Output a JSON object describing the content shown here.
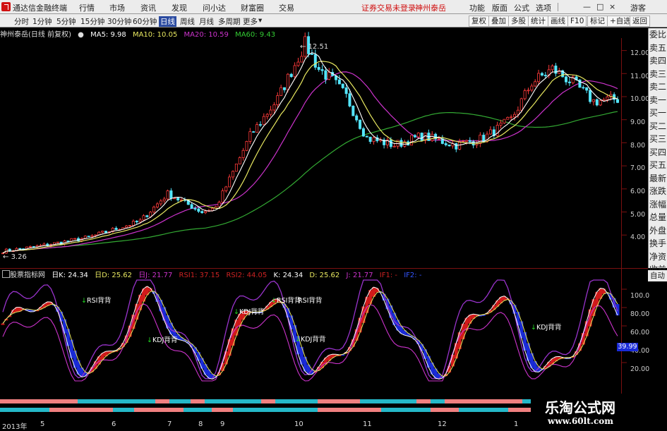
{
  "menubar": {
    "app_title": "通达信金融终端",
    "menus": [
      "行情",
      "市场",
      "资讯",
      "发现",
      "问小达",
      "财富圈",
      "交易"
    ],
    "notice": "证券交易未登录",
    "stock_name": "神州泰岳",
    "right_items": [
      "功能",
      "版面",
      "公式",
      "选项"
    ],
    "guest": "游客"
  },
  "periodbar": {
    "periods": [
      "分时",
      "1分钟",
      "5分钟",
      "15分钟",
      "30分钟",
      "60分钟",
      "日线",
      "周线",
      "月线",
      "多周期",
      "更多"
    ],
    "active_period": "日线",
    "buttons": [
      "复权",
      "叠加",
      "多股",
      "统计",
      "画线",
      "F10",
      "标记",
      "+自选",
      "返回"
    ]
  },
  "chart_info": {
    "title": "神州泰岳(日线 前复权)",
    "ma5": "MA5: 9.98",
    "ma10": "MA10: 10.05",
    "ma20": "MA20: 10.59",
    "ma60": "MA60: 9.43",
    "high_label": "12.51",
    "low_label": "3.26",
    "colors": {
      "ma5": "#ffffff",
      "ma10": "#e8e860",
      "ma20": "#cc33cc",
      "ma60": "#33aa33"
    }
  },
  "indicator": {
    "name": "股票指标网",
    "values": [
      "日K: 24.34",
      "日D: 25.62",
      "日J: 21.77",
      "RSI1: 37.15",
      "RSI2: 44.05",
      "K: 24.34",
      "D: 25.62",
      "J: 21.77",
      "IF1: -",
      "IF2: -"
    ],
    "current": "39.99",
    "signals": [
      {
        "text": "RSI背背"
      },
      {
        "text": "KDJ背背"
      },
      {
        "text": "KDJ背背"
      },
      {
        "text": "RSI背背"
      },
      {
        "text": "RSI背背"
      },
      {
        "text": "KDJ背背"
      },
      {
        "text": "KDJ背背"
      }
    ]
  },
  "right_panel": {
    "items": [
      "委比",
      "卖五",
      "卖四",
      "卖三",
      "卖二",
      "卖一",
      "买一",
      "买二",
      "买三",
      "买四",
      "买五",
      "最新",
      "涨跌",
      "涨幅",
      "总量",
      "外盘",
      "换手",
      "净资",
      "收益"
    ],
    "auto_label": "自动"
  },
  "price_axis": [
    "12.00",
    "11.00",
    "10.00",
    "9.00",
    "8.00",
    "7.00",
    "6.00",
    "5.00",
    "4.00"
  ],
  "ind_axis": [
    "100.0",
    "80.00",
    "60.00",
    "40.00",
    "20.00"
  ],
  "x_axis": [
    "2013年",
    "5",
    "6",
    "7",
    "8",
    "9",
    "10",
    "11",
    "12",
    "1"
  ],
  "watermark": {
    "line1": "乐淘公式网",
    "line2": "www.60lt.com"
  }
}
